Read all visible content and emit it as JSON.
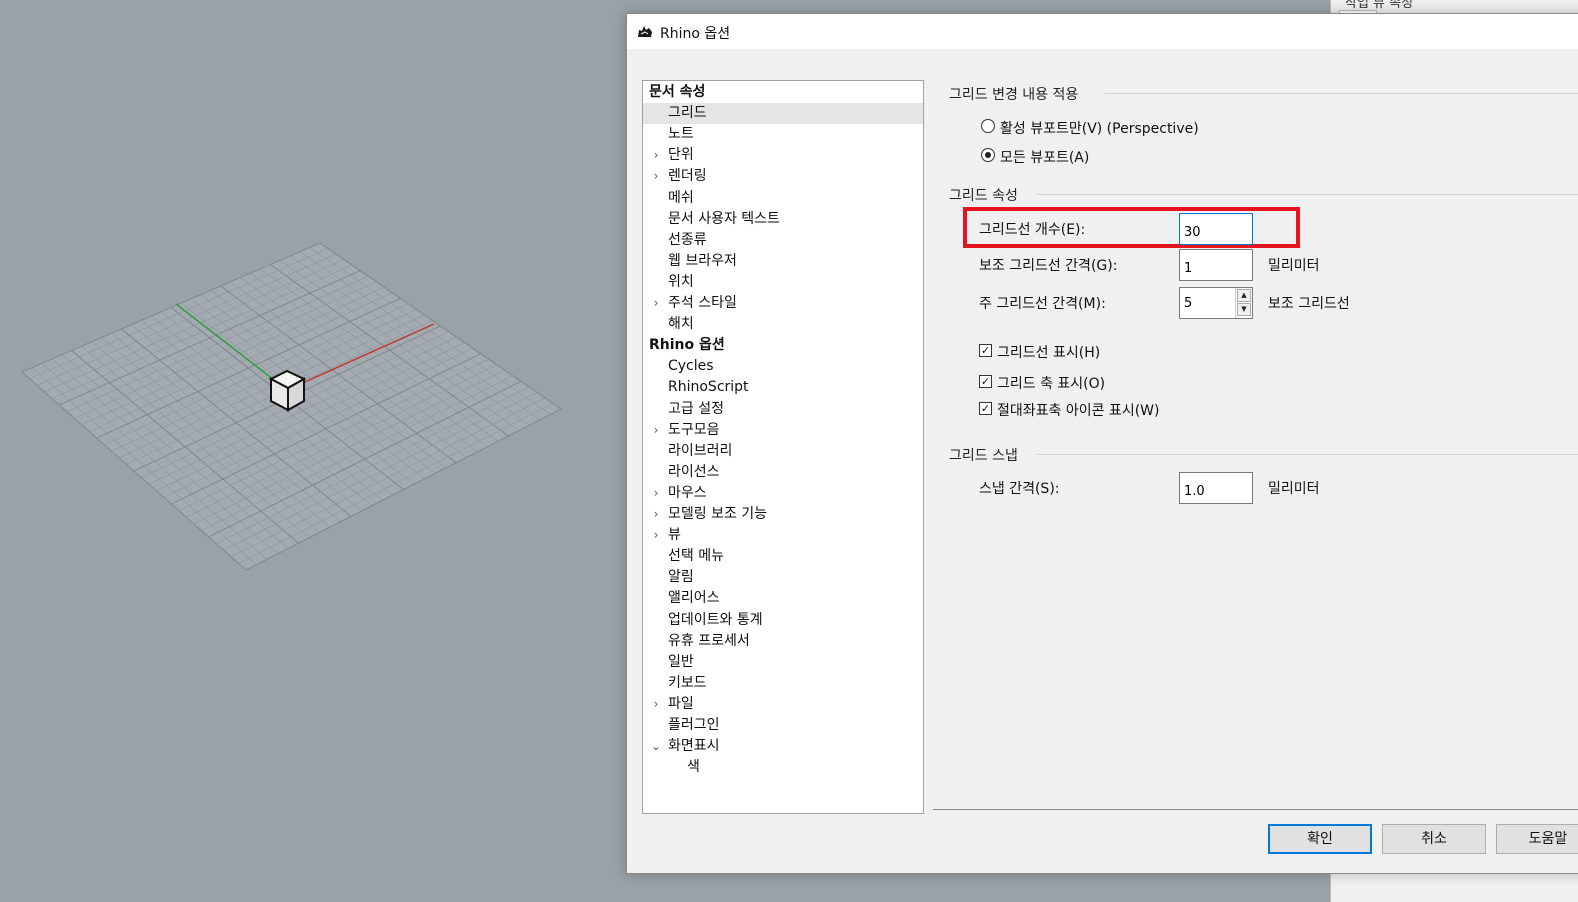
{
  "window": {
    "title": "Rhino 옵션"
  },
  "background_panel": {
    "tab_label": "작업 뷰 속성"
  },
  "tree": {
    "items": [
      {
        "label": "문서 속성",
        "header": true,
        "arrow": ""
      },
      {
        "label": "그리드",
        "selected": true,
        "arrow": ""
      },
      {
        "label": "노트",
        "arrow": ""
      },
      {
        "label": "단위",
        "arrow": "›"
      },
      {
        "label": "렌더링",
        "arrow": "›"
      },
      {
        "label": "메쉬",
        "arrow": ""
      },
      {
        "label": "문서 사용자 텍스트",
        "arrow": ""
      },
      {
        "label": "선종류",
        "arrow": ""
      },
      {
        "label": "웹 브라우저",
        "arrow": ""
      },
      {
        "label": "위치",
        "arrow": ""
      },
      {
        "label": "주석 스타일",
        "arrow": "›"
      },
      {
        "label": "해치",
        "arrow": ""
      },
      {
        "label": "Rhino 옵션",
        "header": true,
        "arrow": ""
      },
      {
        "label": "Cycles",
        "arrow": ""
      },
      {
        "label": "RhinoScript",
        "arrow": ""
      },
      {
        "label": "고급 설정",
        "arrow": ""
      },
      {
        "label": "도구모음",
        "arrow": "›"
      },
      {
        "label": "라이브러리",
        "arrow": ""
      },
      {
        "label": "라이선스",
        "arrow": ""
      },
      {
        "label": "마우스",
        "arrow": "›"
      },
      {
        "label": "모델링 보조 기능",
        "arrow": "›"
      },
      {
        "label": "뷰",
        "arrow": "›"
      },
      {
        "label": "선택 메뉴",
        "arrow": ""
      },
      {
        "label": "알림",
        "arrow": ""
      },
      {
        "label": "앨리어스",
        "arrow": ""
      },
      {
        "label": "업데이트와 통계",
        "arrow": ""
      },
      {
        "label": "유휴 프로세서",
        "arrow": ""
      },
      {
        "label": "일반",
        "arrow": ""
      },
      {
        "label": "키보드",
        "arrow": ""
      },
      {
        "label": "파일",
        "arrow": "›"
      },
      {
        "label": "플러그인",
        "arrow": ""
      },
      {
        "label": "화면표시",
        "arrow": "⌄"
      },
      {
        "label": "색",
        "arrow": "",
        "indent": 2
      }
    ]
  },
  "apply_changes": {
    "title": "그리드 변경 내용 적용",
    "option_active": "활성 뷰포트만(V) (Perspective)",
    "option_all": "모든 뷰포트(A)",
    "selected": "all"
  },
  "grid_properties": {
    "title": "그리드 속성",
    "lines_label": "그리드선 개수(E):",
    "lines_value": "30",
    "minor_label": "보조 그리드선 간격(G):",
    "minor_value": "1",
    "minor_unit": "밀리미터",
    "major_label": "주 그리드선 간격(M):",
    "major_value": "5",
    "major_unit": "보조 그리드선",
    "show_lines_label": "그리드선 표시(H)",
    "show_axes_label": "그리드 축 표시(O)",
    "show_world_icon_label": "절대좌표축 아이콘 표시(W)",
    "show_lines": true,
    "show_axes": true,
    "show_world_icon": true
  },
  "grid_snap": {
    "title": "그리드 스냅",
    "spacing_label": "스냅 간격(S):",
    "spacing_value": "1.0",
    "spacing_unit": "밀리미터"
  },
  "buttons": {
    "ok": "확인",
    "cancel": "취소",
    "help": "도움말"
  },
  "icons": {
    "check": "✓",
    "spin_up": "▲",
    "spin_down": "▼"
  },
  "colors": {
    "highlight": "#e5141e",
    "x_axis": "#c0392b",
    "y_axis": "#2e9e3a",
    "focus": "#0078d7"
  }
}
